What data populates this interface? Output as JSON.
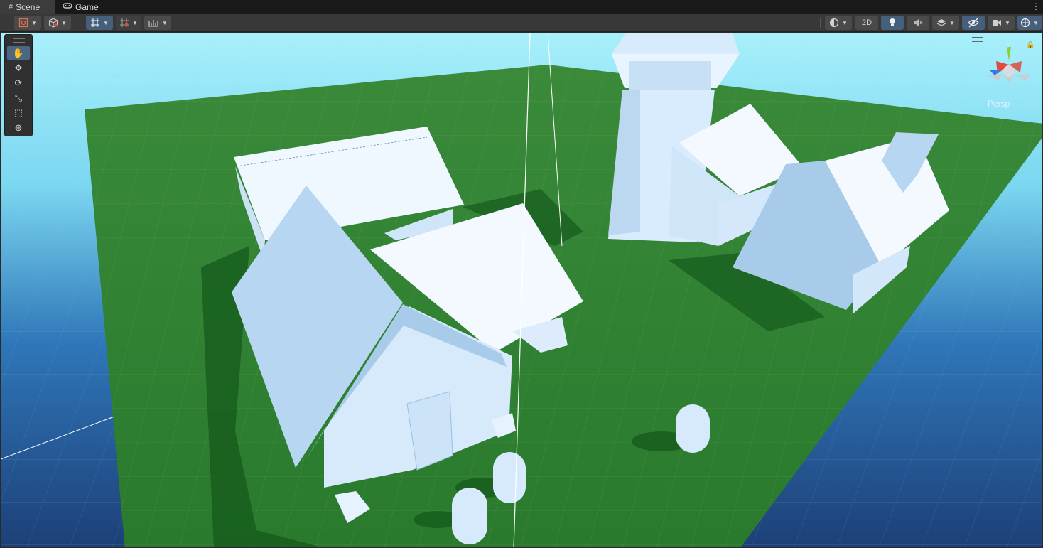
{
  "tabs": [
    {
      "label": "Scene",
      "icon": "grid-icon",
      "active": true
    },
    {
      "label": "Game",
      "icon": "gamepad-icon",
      "active": false
    }
  ],
  "toolbar": {
    "button_2d": "2D",
    "accent": "#46607c"
  },
  "tools": [
    {
      "name": "hand-tool",
      "glyph": "✋",
      "active": true
    },
    {
      "name": "move-tool",
      "glyph": "✥",
      "active": false
    },
    {
      "name": "rotate-tool",
      "glyph": "⟳",
      "active": false
    },
    {
      "name": "scale-tool",
      "glyph": "⤡",
      "active": false
    },
    {
      "name": "rect-tool",
      "glyph": "⬚",
      "active": false
    },
    {
      "name": "transform-tool",
      "glyph": "⊕",
      "active": false
    }
  ],
  "gizmo": {
    "projection": "Persp",
    "axis_colors": {
      "x": "#e04a3a",
      "y": "#8ccf3a",
      "z": "#3a78e0"
    }
  }
}
